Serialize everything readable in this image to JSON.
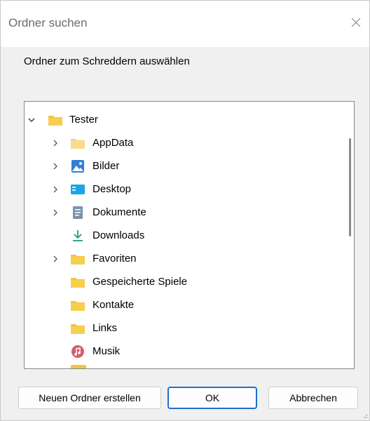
{
  "window": {
    "title": "Ordner suchen"
  },
  "prompt": "Ordner zum Schreddern auswählen",
  "tree": {
    "root": {
      "label": "Tester",
      "icon": "folder-icon",
      "expanded": true
    },
    "children": [
      {
        "label": "AppData",
        "icon": "folder-light-icon",
        "expandable": true
      },
      {
        "label": "Bilder",
        "icon": "pictures-icon",
        "expandable": true
      },
      {
        "label": "Desktop",
        "icon": "desktop-icon",
        "expandable": true
      },
      {
        "label": "Dokumente",
        "icon": "documents-icon",
        "expandable": true
      },
      {
        "label": "Downloads",
        "icon": "downloads-icon",
        "expandable": false
      },
      {
        "label": "Favoriten",
        "icon": "folder-icon",
        "expandable": true
      },
      {
        "label": "Gespeicherte Spiele",
        "icon": "folder-icon",
        "expandable": false
      },
      {
        "label": "Kontakte",
        "icon": "folder-icon",
        "expandable": false
      },
      {
        "label": "Links",
        "icon": "folder-icon",
        "expandable": false
      },
      {
        "label": "Musik",
        "icon": "music-icon",
        "expandable": false
      }
    ]
  },
  "buttons": {
    "new_folder": "Neuen Ordner erstellen",
    "ok": "OK",
    "cancel": "Abbrechen"
  },
  "colors": {
    "folder": "#f4c53c",
    "folder_light": "#f8dc8a",
    "accent": "#1f6fd0",
    "downloads": "#1e9e74",
    "music": "#d65d6e"
  }
}
